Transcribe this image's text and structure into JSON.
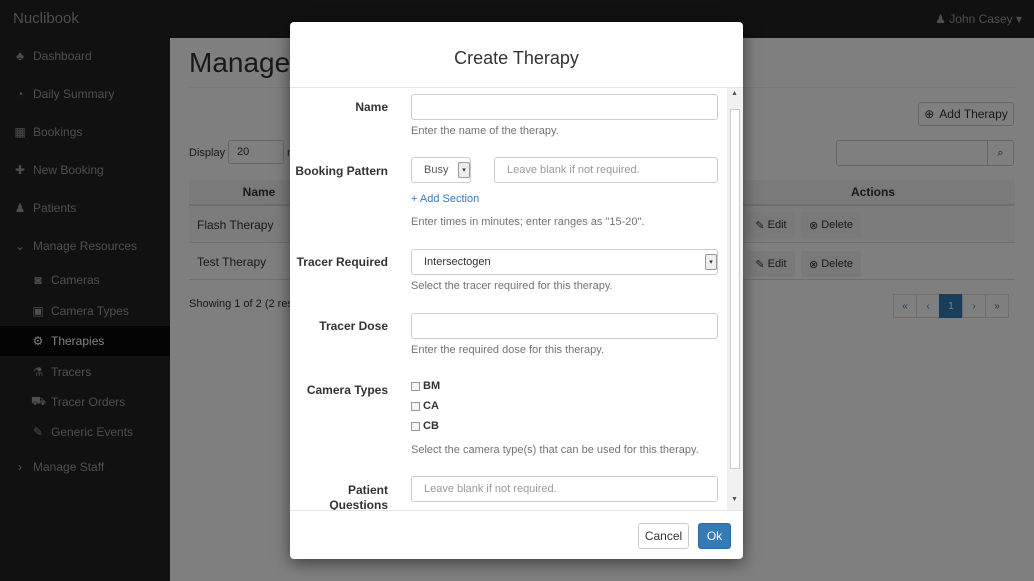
{
  "app": {
    "brand": "Nuclibook",
    "user": "John Casey",
    "user_caret": "▾",
    "user_icon": "♟"
  },
  "sidebar": {
    "items": [
      {
        "label": "Dashboard",
        "icon": "♣"
      },
      {
        "label": "Daily Summary",
        "icon": "◔"
      },
      {
        "label": "Bookings",
        "icon": "▦"
      },
      {
        "label": "New Booking",
        "icon": "✚"
      },
      {
        "label": "Patients",
        "icon": "♟"
      },
      {
        "label": "Manage Resources",
        "icon": "⌄"
      },
      {
        "label": "Cameras",
        "icon": "◙"
      },
      {
        "label": "Camera Types",
        "icon": "▣"
      },
      {
        "label": "Therapies",
        "icon": "⚙"
      },
      {
        "label": "Tracers",
        "icon": "⚗"
      },
      {
        "label": "Tracer Orders",
        "icon": "⛟"
      },
      {
        "label": "Generic Events",
        "icon": "✎"
      },
      {
        "label": "Manage Staff",
        "icon": "›"
      }
    ]
  },
  "main": {
    "title": "Manage",
    "add_button": "Add Therapy",
    "add_icon": "⊕",
    "display_label": "Display",
    "display_value": "20",
    "display_suffix": "r",
    "search_icon": "⌕",
    "columns": {
      "name": "Name",
      "actions": "Actions"
    },
    "rows": [
      {
        "name": "Flash Therapy",
        "edit": "Edit",
        "delete": "Delete"
      },
      {
        "name": "Test Therapy",
        "edit": "Edit",
        "delete": "Delete"
      }
    ],
    "edit_icon": "✎",
    "delete_icon": "⊗",
    "showing": "Showing 1 of 2 (2 res",
    "pager": {
      "first": "«",
      "prev": "‹",
      "current": "1",
      "next": "›",
      "last": "»"
    }
  },
  "modal": {
    "title": "Create Therapy",
    "name_label": "Name",
    "name_value": "",
    "name_help": "Enter the name of the therapy.",
    "pattern_label": "Booking Pattern",
    "pattern_select": "Busy",
    "pattern_caret": "▾",
    "pattern_placeholder": "Leave blank if not required.",
    "add_section": "+ Add Section",
    "pattern_help": "Enter times in minutes; enter ranges as \"15-20\".",
    "tracer_label": "Tracer Required",
    "tracer_value": "Intersectogen",
    "tracer_help": "Select the tracer required for this therapy.",
    "dose_label": "Tracer Dose",
    "dose_value": "",
    "dose_help": "Enter the required dose for this therapy.",
    "camera_label": "Camera Types",
    "camera_options": [
      "BM",
      "CA",
      "CB"
    ],
    "camera_help": "Select the camera type(s) that can be used for this therapy.",
    "questions_label_1": "Patient",
    "questions_label_2": "Questions",
    "questions_placeholder": "Leave blank if not required.",
    "cancel": "Cancel",
    "ok": "Ok",
    "scroll_up": "▲",
    "scroll_down": "▼"
  }
}
